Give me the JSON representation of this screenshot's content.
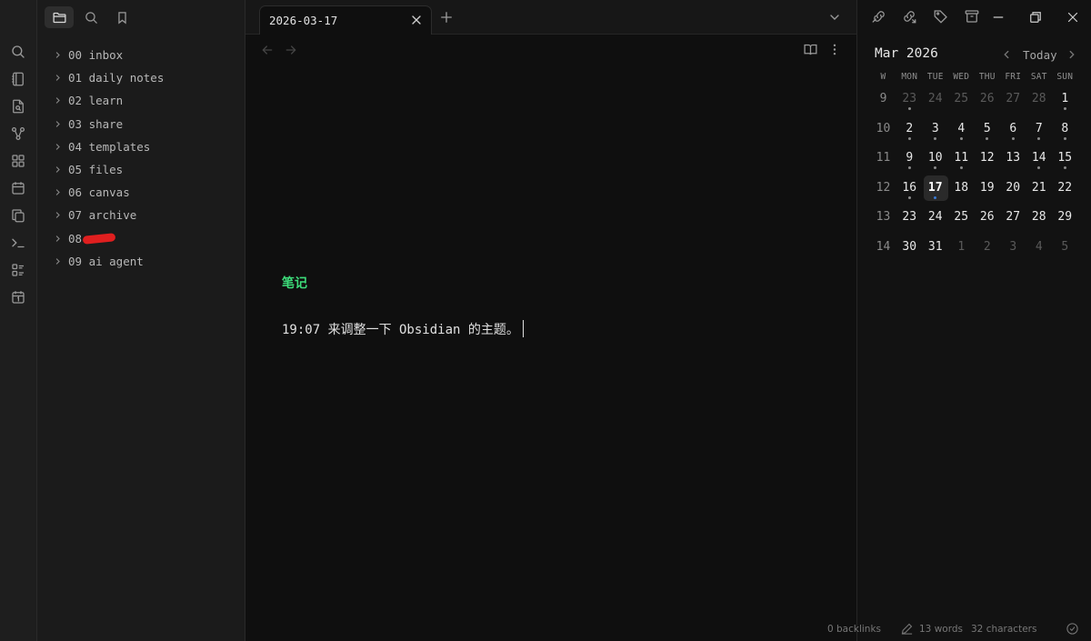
{
  "ribbon": {
    "icons": [
      "search-icon",
      "notebook-icon",
      "file-search-icon",
      "graph-icon",
      "grid-icon",
      "calendar-icon",
      "copy-icon",
      "terminal-icon",
      "layout-list-icon",
      "calendar-day-icon"
    ]
  },
  "sidebar": {
    "tabs": [
      "folder-icon",
      "search-icon",
      "bookmark-icon"
    ],
    "active_tab": "folder-icon",
    "folders": [
      {
        "label": "00 inbox"
      },
      {
        "label": "01 daily notes"
      },
      {
        "label": "02 learn"
      },
      {
        "label": "03 share"
      },
      {
        "label": "04 templates"
      },
      {
        "label": "05 files"
      },
      {
        "label": "06 canvas"
      },
      {
        "label": "07 archive"
      },
      {
        "label": "08",
        "redacted": true
      },
      {
        "label": "09 ai agent"
      }
    ]
  },
  "editor": {
    "tab_title": "2026-03-17",
    "heading": "笔记",
    "line": "19:07 来调整一下 Obsidian 的主题。",
    "heading_color": "#3ddc7a"
  },
  "calendar": {
    "month_label": "Mar 2026",
    "today_label": "Today",
    "weekday_headers": [
      "W",
      "MON",
      "TUE",
      "WED",
      "THU",
      "FRI",
      "SAT",
      "SUN"
    ],
    "weeks": [
      {
        "wk": "9",
        "days": [
          [
            "23",
            "other",
            1
          ],
          [
            "24",
            "other",
            0
          ],
          [
            "25",
            "other",
            0
          ],
          [
            "26",
            "other",
            0
          ],
          [
            "27",
            "other",
            0
          ],
          [
            "28",
            "other",
            0
          ],
          [
            "1",
            "cur",
            1
          ]
        ]
      },
      {
        "wk": "10",
        "days": [
          [
            "2",
            "cur",
            1
          ],
          [
            "3",
            "cur",
            1
          ],
          [
            "4",
            "cur",
            1
          ],
          [
            "5",
            "cur",
            1
          ],
          [
            "6",
            "cur",
            1
          ],
          [
            "7",
            "cur",
            1
          ],
          [
            "8",
            "cur",
            1
          ]
        ]
      },
      {
        "wk": "11",
        "days": [
          [
            "9",
            "cur",
            1
          ],
          [
            "10",
            "cur",
            1
          ],
          [
            "11",
            "cur",
            1
          ],
          [
            "12",
            "cur",
            0
          ],
          [
            "13",
            "cur",
            0
          ],
          [
            "14",
            "cur",
            1
          ],
          [
            "15",
            "cur",
            1
          ]
        ]
      },
      {
        "wk": "12",
        "days": [
          [
            "16",
            "cur",
            1
          ],
          [
            "17",
            "today",
            2
          ],
          [
            "18",
            "cur",
            0
          ],
          [
            "19",
            "cur",
            0
          ],
          [
            "20",
            "cur",
            0
          ],
          [
            "21",
            "cur",
            0
          ],
          [
            "22",
            "cur",
            0
          ]
        ]
      },
      {
        "wk": "13",
        "days": [
          [
            "23",
            "cur",
            0
          ],
          [
            "24",
            "cur",
            0
          ],
          [
            "25",
            "cur",
            0
          ],
          [
            "26",
            "cur",
            0
          ],
          [
            "27",
            "cur",
            0
          ],
          [
            "28",
            "cur",
            0
          ],
          [
            "29",
            "cur",
            0
          ]
        ]
      },
      {
        "wk": "14",
        "days": [
          [
            "30",
            "cur",
            0
          ],
          [
            "31",
            "cur",
            0
          ],
          [
            "1",
            "other",
            0
          ],
          [
            "2",
            "other",
            0
          ],
          [
            "3",
            "other",
            0
          ],
          [
            "4",
            "other",
            0
          ],
          [
            "5",
            "other",
            0
          ]
        ]
      }
    ],
    "dot_color": "#8a8a8a",
    "today_dot_color": "#3a7bd5"
  },
  "status_bar": {
    "backlinks": "0 backlinks",
    "words": "13 words",
    "characters": "32 characters"
  }
}
